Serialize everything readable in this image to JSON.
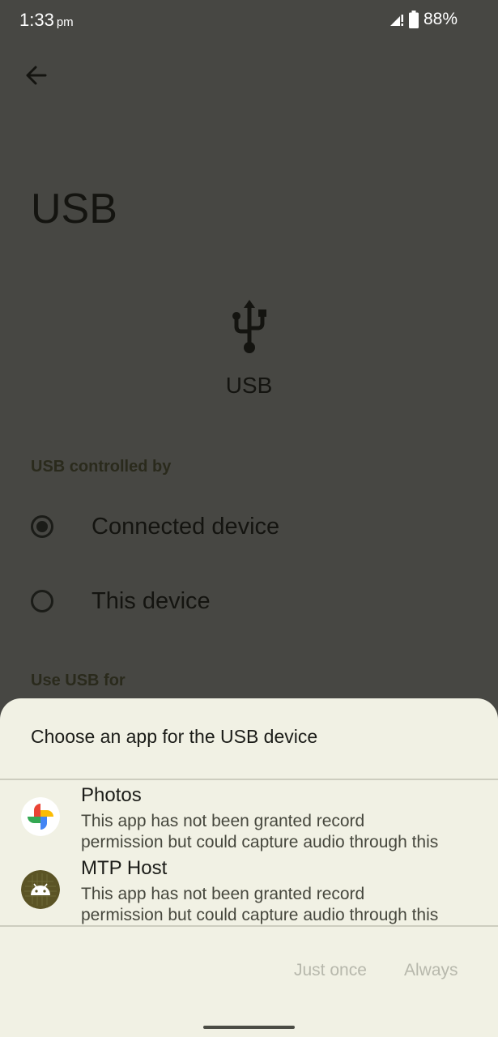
{
  "status_bar": {
    "time": "1:33",
    "ampm": "pm",
    "battery": "88%"
  },
  "page": {
    "title": "USB",
    "usb_label": "USB",
    "section_controlled_by": "USB controlled by",
    "options": [
      {
        "label": "Connected device",
        "selected": true
      },
      {
        "label": "This device",
        "selected": false
      }
    ],
    "section_use_for": "Use USB for"
  },
  "dialog": {
    "title": "Choose an app for the USB device",
    "apps": [
      {
        "name": "Photos",
        "desc_line1": "This app has not been granted record",
        "desc_line2": "permission but could capture audio through this",
        "icon": "photos-icon"
      },
      {
        "name": "MTP Host",
        "desc_line1": "This app has not been granted record",
        "desc_line2": "permission but could capture audio through this",
        "icon": "android-icon"
      }
    ],
    "just_once_label": "Just once",
    "always_label": "Always"
  },
  "colors": {
    "background": "#474743",
    "sheet": "#f1f1e4",
    "disabled_text": "#b7b8ac"
  }
}
